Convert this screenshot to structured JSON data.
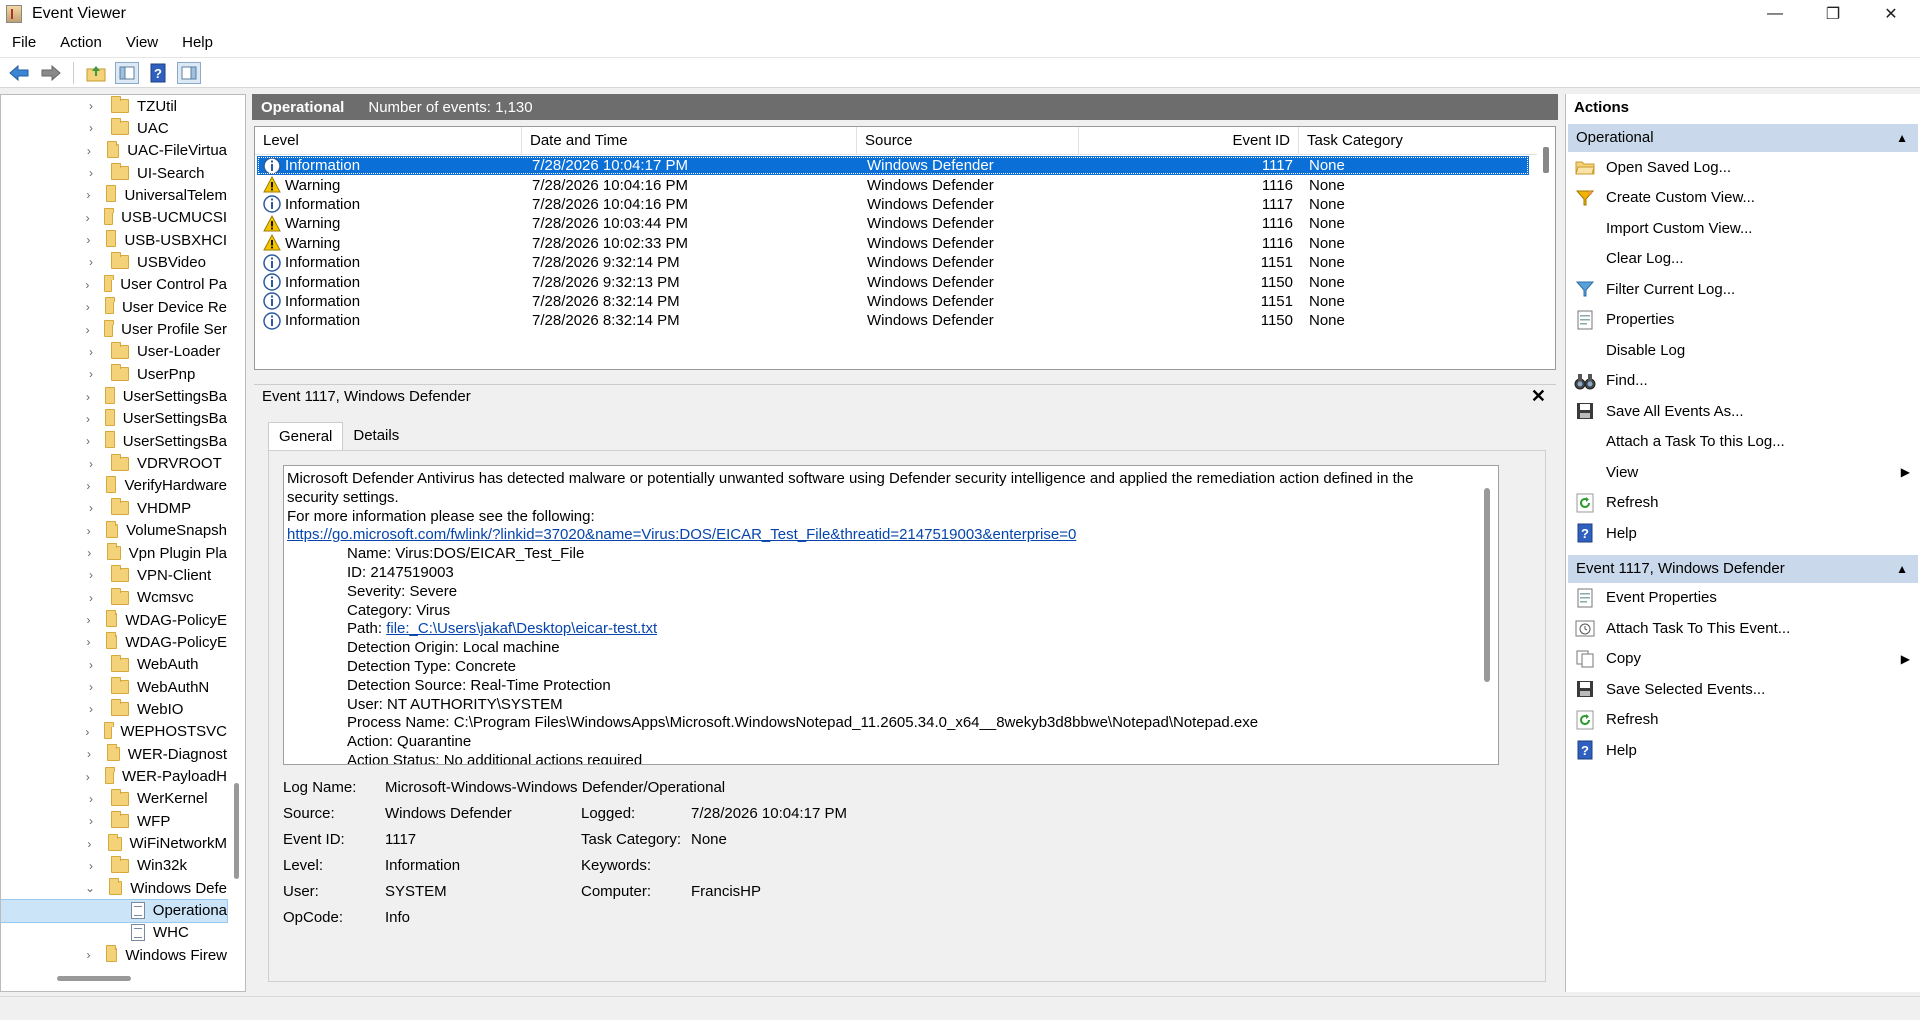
{
  "window": {
    "title": "Event Viewer",
    "minimize": "—",
    "restore": "❐",
    "close": "✕"
  },
  "menu": [
    "File",
    "Action",
    "View",
    "Help"
  ],
  "tree": {
    "items": [
      {
        "label": "TZUtil",
        "chevron": "›"
      },
      {
        "label": "UAC",
        "chevron": "›"
      },
      {
        "label": "UAC-FileVirtua",
        "chevron": "›"
      },
      {
        "label": "UI-Search",
        "chevron": "›"
      },
      {
        "label": "UniversalTelem",
        "chevron": "›"
      },
      {
        "label": "USB-UCMUCSI",
        "chevron": "›"
      },
      {
        "label": "USB-USBXHCI",
        "chevron": "›"
      },
      {
        "label": "USBVideo",
        "chevron": "›"
      },
      {
        "label": "User Control Pa",
        "chevron": "›"
      },
      {
        "label": "User Device Re",
        "chevron": "›"
      },
      {
        "label": "User Profile Ser",
        "chevron": "›"
      },
      {
        "label": "User-Loader",
        "chevron": "›"
      },
      {
        "label": "UserPnp",
        "chevron": "›"
      },
      {
        "label": "UserSettingsBa",
        "chevron": "›"
      },
      {
        "label": "UserSettingsBa",
        "chevron": "›"
      },
      {
        "label": "UserSettingsBa",
        "chevron": "›"
      },
      {
        "label": "VDRVROOT",
        "chevron": "›"
      },
      {
        "label": "VerifyHardware",
        "chevron": "›"
      },
      {
        "label": "VHDMP",
        "chevron": "›"
      },
      {
        "label": "VolumeSnapsh",
        "chevron": "›"
      },
      {
        "label": "Vpn Plugin Pla",
        "chevron": "›"
      },
      {
        "label": "VPN-Client",
        "chevron": "›"
      },
      {
        "label": "Wcmsvc",
        "chevron": "›"
      },
      {
        "label": "WDAG-PolicyE",
        "chevron": "›"
      },
      {
        "label": "WDAG-PolicyE",
        "chevron": "›"
      },
      {
        "label": "WebAuth",
        "chevron": "›"
      },
      {
        "label": "WebAuthN",
        "chevron": "›"
      },
      {
        "label": "WebIO",
        "chevron": "›"
      },
      {
        "label": "WEPHOSTSVC",
        "chevron": "›"
      },
      {
        "label": "WER-Diagnost",
        "chevron": "›"
      },
      {
        "label": "WER-PayloadH",
        "chevron": "›"
      },
      {
        "label": "WerKernel",
        "chevron": "›"
      },
      {
        "label": "WFP",
        "chevron": "›"
      },
      {
        "label": "WiFiNetworkM",
        "chevron": "›"
      },
      {
        "label": "Win32k",
        "chevron": "›"
      },
      {
        "label": "Windows Defe",
        "chevron": "⌄"
      }
    ],
    "children": [
      "Operationa",
      "WHC"
    ],
    "last": {
      "label": "Windows Firew",
      "chevron": "›"
    }
  },
  "grid": {
    "title": "Operational",
    "count": "Number of events: 1,130",
    "columns": {
      "level": "Level",
      "date": "Date and Time",
      "source": "Source",
      "id": "Event ID",
      "task": "Task Category"
    },
    "rows": [
      {
        "level": "Information",
        "type": "info",
        "date": "7/28/2026 10:04:17 PM",
        "source": "Windows Defender",
        "id": "1117",
        "task": "None"
      },
      {
        "level": "Warning",
        "type": "warn",
        "date": "7/28/2026 10:04:16 PM",
        "source": "Windows Defender",
        "id": "1116",
        "task": "None"
      },
      {
        "level": "Information",
        "type": "info",
        "date": "7/28/2026 10:04:16 PM",
        "source": "Windows Defender",
        "id": "1117",
        "task": "None"
      },
      {
        "level": "Warning",
        "type": "warn",
        "date": "7/28/2026 10:03:44 PM",
        "source": "Windows Defender",
        "id": "1116",
        "task": "None"
      },
      {
        "level": "Warning",
        "type": "warn",
        "date": "7/28/2026 10:02:33 PM",
        "source": "Windows Defender",
        "id": "1116",
        "task": "None"
      },
      {
        "level": "Information",
        "type": "info",
        "date": "7/28/2026 9:32:14 PM",
        "source": "Windows Defender",
        "id": "1151",
        "task": "None"
      },
      {
        "level": "Information",
        "type": "info",
        "date": "7/28/2026 9:32:13 PM",
        "source": "Windows Defender",
        "id": "1150",
        "task": "None"
      },
      {
        "level": "Information",
        "type": "info",
        "date": "7/28/2026 8:32:14 PM",
        "source": "Windows Defender",
        "id": "1151",
        "task": "None"
      },
      {
        "level": "Information",
        "type": "info",
        "date": "7/28/2026 8:32:14 PM",
        "source": "Windows Defender",
        "id": "1150",
        "task": "None"
      }
    ]
  },
  "detail": {
    "title": "Event 1117, Windows Defender",
    "close": "✕",
    "tabs": [
      "General",
      "Details"
    ],
    "message": {
      "intro": "Microsoft Defender Antivirus has detected malware or potentially unwanted software using Defender security intelligence and applied the remediation action defined in the security settings.",
      "more": " For more information please see the following:",
      "url": "https://go.microsoft.com/fwlink/?linkid=37020&name=Virus:DOS/EICAR_Test_File&threatid=2147519003&enterprise=0",
      "name": "Name: Virus:DOS/EICAR_Test_File",
      "id": "ID: 2147519003",
      "severity": "Severity: Severe",
      "category": "Category: Virus",
      "path_label": "Path: ",
      "path_link": "file:_C:\\Users\\jakaf\\Desktop\\eicar-test.txt",
      "origin": "Detection Origin: Local machine",
      "type": "Detection Type: Concrete",
      "source": "Detection Source: Real-Time Protection",
      "user": "User: NT AUTHORITY\\SYSTEM",
      "process": "Process Name: C:\\Program Files\\WindowsApps\\Microsoft.WindowsNotepad_11.2605.34.0_x64__8wekyb3d8bbwe\\Notepad\\Notepad.exe",
      "action": "Action: Quarantine",
      "status": "Action Status:  No additional actions required"
    },
    "props": {
      "log_name_label": "Log Name:",
      "log_name": "Microsoft-Windows-Windows Defender/Operational",
      "source_label": "Source:",
      "source": "Windows Defender",
      "logged_label": "Logged:",
      "logged": "7/28/2026 10:04:17 PM",
      "event_id_label": "Event ID:",
      "event_id": "1117",
      "task_label": "Task Category:",
      "task": "None",
      "level_label": "Level:",
      "level": "Information",
      "keywords_label": "Keywords:",
      "keywords": "",
      "user_label": "User:",
      "user": "SYSTEM",
      "computer_label": "Computer:",
      "computer": "FrancisHP",
      "opcode_label": "OpCode:",
      "opcode": "Info"
    }
  },
  "actions": {
    "title": "Actions",
    "section1": "Operational",
    "section2": "Event 1117, Windows Defender",
    "items1": [
      {
        "label": "Open Saved Log...",
        "icon": "open-folder-icon"
      },
      {
        "label": "Create Custom View...",
        "icon": "funnel-star-icon"
      },
      {
        "label": "Import Custom View...",
        "icon": ""
      },
      {
        "label": "Clear Log...",
        "icon": ""
      },
      {
        "label": "Filter Current Log...",
        "icon": "filter-icon"
      },
      {
        "label": "Properties",
        "icon": "properties-icon"
      },
      {
        "label": "Disable Log",
        "icon": ""
      },
      {
        "label": "Find...",
        "icon": "binoculars-icon"
      },
      {
        "label": "Save All Events As...",
        "icon": "save-icon"
      },
      {
        "label": "Attach a Task To this Log...",
        "icon": ""
      },
      {
        "label": "View",
        "icon": "",
        "submenu": "▶"
      },
      {
        "label": "Refresh",
        "icon": "refresh-icon"
      },
      {
        "label": "Help",
        "icon": "help-icon"
      }
    ],
    "items2": [
      {
        "label": "Event Properties",
        "icon": "properties-icon"
      },
      {
        "label": "Attach Task To This Event...",
        "icon": "task-icon"
      },
      {
        "label": "Copy",
        "icon": "copy-icon",
        "submenu": "▶"
      },
      {
        "label": "Save Selected Events...",
        "icon": "save-icon"
      },
      {
        "label": "Refresh",
        "icon": "refresh-icon"
      },
      {
        "label": "Help",
        "icon": "help-icon"
      }
    ],
    "caret": "▲"
  },
  "colors": {
    "selection": "#0a6fd6",
    "section": "#c9d9eb",
    "header": "#6d6d6d",
    "link": "#0645ad"
  }
}
